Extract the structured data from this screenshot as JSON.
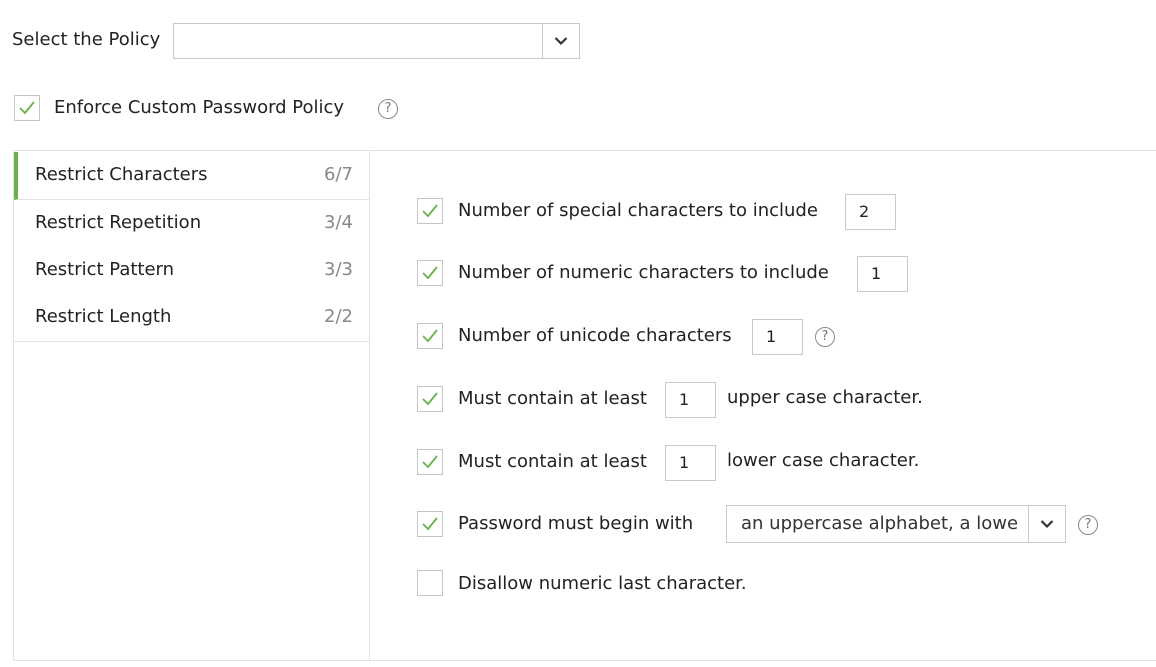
{
  "policy": {
    "label": "Select the Policy",
    "value": ""
  },
  "enforce": {
    "label": "Enforce Custom Password Policy",
    "checked": true,
    "help": "?"
  },
  "sidebar": {
    "items": [
      {
        "label": "Restrict Characters",
        "count": "6/7",
        "active": true
      },
      {
        "label": "Restrict Repetition",
        "count": "3/4",
        "active": false
      },
      {
        "label": "Restrict Pattern",
        "count": "3/3",
        "active": false
      },
      {
        "label": "Restrict Length",
        "count": "2/2",
        "active": false
      }
    ]
  },
  "rules": {
    "special": {
      "label": "Number of special characters to include",
      "value": "2",
      "checked": true
    },
    "numeric": {
      "label": "Number of numeric characters to include",
      "value": "1",
      "checked": true
    },
    "unicode": {
      "label": "Number of unicode characters",
      "value": "1",
      "checked": true,
      "help": "?"
    },
    "upper": {
      "label": "Must contain at least",
      "value": "1",
      "suffix": "upper case character.",
      "checked": true
    },
    "lower": {
      "label": "Must contain at least",
      "value": "1",
      "suffix": "lower case character.",
      "checked": true
    },
    "begin": {
      "label": "Password must begin with",
      "value": "an uppercase alphabet, a lowe",
      "checked": true,
      "help": "?"
    },
    "numeric_last": {
      "label": "Disallow numeric last character.",
      "checked": false
    }
  },
  "colors": {
    "accent": "#6ab04c",
    "border": "#c9c9c9"
  }
}
